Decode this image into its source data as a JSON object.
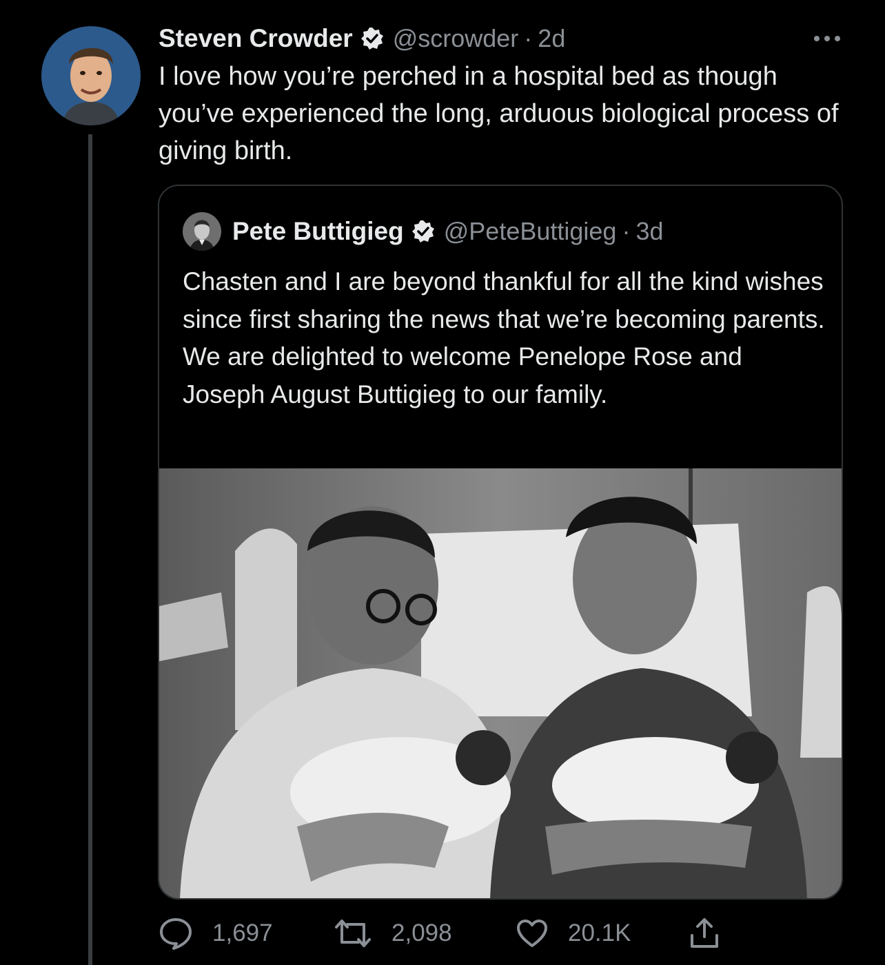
{
  "tweet": {
    "author_name": "Steven Crowder",
    "author_handle": "@scrowder",
    "separator": "·",
    "age": "2d",
    "text": "I love how you’re perched in a hospital bed as though you’ve experienced the long, arduous biological process of giving birth."
  },
  "quoted": {
    "author_name": "Pete Buttigieg",
    "author_handle": "@PeteButtigieg",
    "separator": "·",
    "age": "3d",
    "text": "Chasten and I are beyond thankful for all the kind wishes since first sharing the news that we’re becoming parents. We are delighted to welcome Penelope Rose and Joseph August Buttigieg to our family."
  },
  "actions": {
    "replies": "1,697",
    "retweets": "2,098",
    "likes": "20.1K"
  },
  "icons": {
    "verified": "verified-badge-icon",
    "more": "more-dots-icon",
    "reply": "reply-bubble-icon",
    "retweet": "retweet-icon",
    "like": "heart-icon",
    "share": "share-icon"
  },
  "colors": {
    "background": "#000000",
    "text": "#e7e9ea",
    "secondary": "#8b9096",
    "border": "#2f3336"
  }
}
